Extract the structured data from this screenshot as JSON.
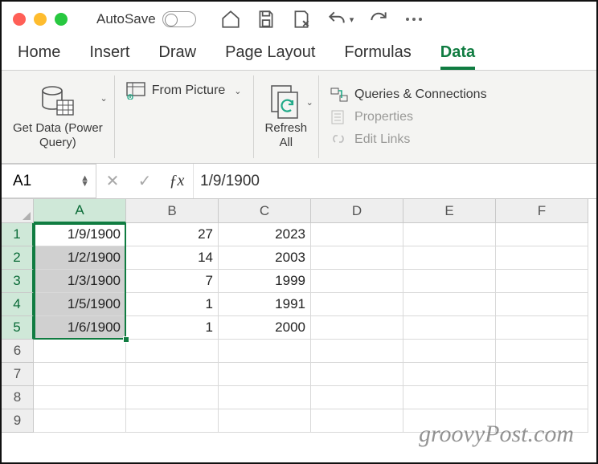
{
  "titlebar": {
    "autosave_label": "AutoSave"
  },
  "tabs": [
    "Home",
    "Insert",
    "Draw",
    "Page Layout",
    "Formulas",
    "Data"
  ],
  "active_tab": "Data",
  "ribbon": {
    "get_data_label": "Get Data (Power\nQuery)",
    "from_picture_label": "From Picture",
    "refresh_all_label": "Refresh\nAll",
    "queries_label": "Queries & Connections",
    "properties_label": "Properties",
    "edit_links_label": "Edit Links"
  },
  "formula_bar": {
    "name_box": "A1",
    "value": "1/9/1900"
  },
  "columns": [
    "A",
    "B",
    "C",
    "D",
    "E",
    "F"
  ],
  "selected_column": "A",
  "rows": [
    1,
    2,
    3,
    4,
    5,
    6,
    7,
    8,
    9
  ],
  "selected_rows": [
    1,
    2,
    3,
    4,
    5
  ],
  "data": [
    {
      "A": "1/9/1900",
      "B": "27",
      "C": "2023"
    },
    {
      "A": "1/2/1900",
      "B": "14",
      "C": "2003"
    },
    {
      "A": "1/3/1900",
      "B": "7",
      "C": "1999"
    },
    {
      "A": "1/5/1900",
      "B": "1",
      "C": "1991"
    },
    {
      "A": "1/6/1900",
      "B": "1",
      "C": "2000"
    }
  ],
  "watermark": "groovyPost.com"
}
